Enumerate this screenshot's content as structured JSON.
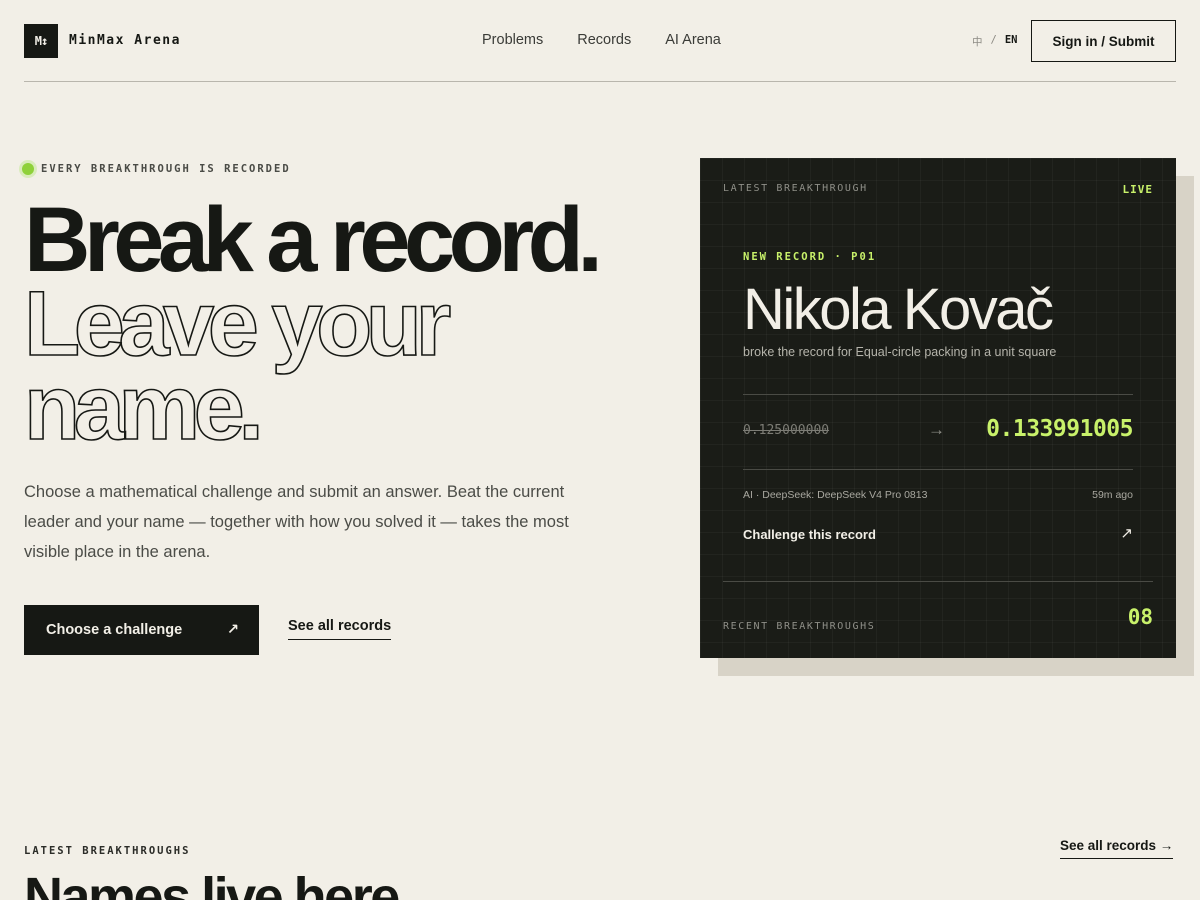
{
  "header": {
    "logo_mark": "M↕",
    "logo_text": "MinMax Arena",
    "nav": [
      "Problems",
      "Records",
      "AI Arena"
    ],
    "lang_zh": "中",
    "lang_sep": "/",
    "lang_en": "EN",
    "signin_label": "Sign in / Submit"
  },
  "hero": {
    "eyebrow": "EVERY BREAKTHROUGH IS RECORDED",
    "headline_line1": "Break a record.",
    "headline_line2": "Leave your",
    "headline_line3": "name.",
    "description": "Choose a mathematical challenge and submit an answer. Beat the current leader and your name — together with how you solved it — takes the most visible place in the arena.",
    "primary_cta": "Choose a challenge",
    "primary_cta_icon": "↗",
    "secondary_cta": "See all records"
  },
  "card": {
    "label": "LATEST BREAKTHROUGH",
    "live": "LIVE",
    "new_record_tag": "NEW RECORD · P01",
    "holder": "Nikola Kovač",
    "description": "broke the record for Equal-circle packing in a unit square",
    "old_value": "0.125000000",
    "arrow": "→",
    "new_value": "0.133991005",
    "solver": "AI · DeepSeek: DeepSeek V4 Pro 0813",
    "time_ago": "59m ago",
    "challenge_label": "Challenge this record",
    "challenge_icon": "↗",
    "recent_label": "RECENT BREAKTHROUGHS",
    "recent_count": "08"
  },
  "latest": {
    "label": "LATEST BREAKTHROUGHS",
    "link": "See all records →",
    "title": "Names live here"
  },
  "colors": {
    "background": "#f2efe7",
    "ink": "#161814",
    "accent": "#c8f16a",
    "card_bg": "#1a1c17"
  }
}
